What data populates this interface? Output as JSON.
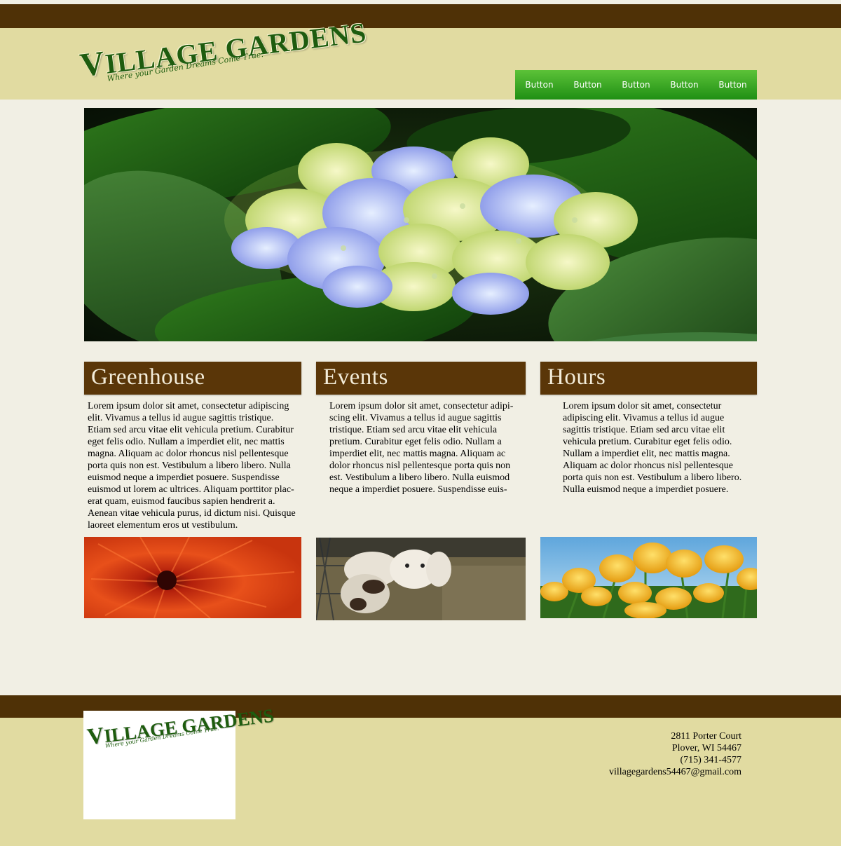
{
  "brand": {
    "name_first": "V",
    "name_rest": "ILLAGE GARDENS",
    "tagline": "Where your Garden Dreams Come True."
  },
  "nav": {
    "buttons": [
      "Button",
      "Button",
      "Button",
      "Button",
      "Button"
    ]
  },
  "columns": [
    {
      "title": "Greenhouse",
      "body": "Lorem ipsum dolor sit amet, consectetur adipiscing elit. Vivamus a tellus id augue sagittis tristique. Etiam sed arcu vitae elit vehicula pretium. Curabitur eget felis odio. Nullam a imperdiet elit, nec mattis magna. Aliquam ac dolor rhoncus nisl pellentesque porta quis non est. Vestibulum a libero libero. Nulla euismod neque a imperdiet posuere. Suspendisse euismod ut lorem ac ultrices. Aliquam porttitor plac-erat quam, euismod faucibus sapien hendrerit a. Aenean vitae vehicula purus, id dictum nisi. Quisque laoreet elementum eros ut vestibulum.",
      "image": "red-chrysanthemum"
    },
    {
      "title": "Events",
      "body": "Lorem ipsum dolor sit amet, consectetur adipi-scing elit. Vivamus a tellus id augue sagittis tristique. Etiam sed arcu vitae elit vehicula pretium. Curabitur eget felis odio. Nullam a imperdiet elit, nec mattis magna. Aliquam ac dolor rhoncus nisl pellentesque porta quis non est. Vestibulum a libero libero. Nulla euismod neque a imperdiet posuere. Suspendisse euis-",
      "image": "goats"
    },
    {
      "title": "Hours",
      "body": "Lorem ipsum dolor sit amet, consectetur adipiscing elit. Vivamus a tellus id augue sagittis tristique. Etiam sed arcu vitae elit vehicula pretium. Curabitur eget felis odio. Nullam a imperdiet elit, nec mattis magna. Aliquam ac dolor rhoncus nisl pellentesque porta quis non est. Vestibulum a libero libero. Nulla euismod neque a imperdiet posuere.",
      "image": "yellow-tulips"
    }
  ],
  "hero": {
    "image": "blue-hydrangea"
  },
  "footer": {
    "address_line1": "2811 Porter Court",
    "address_line2": "Plover, WI 54467",
    "phone": "(715) 341-4577",
    "email": "villagegardens54467@gmail.com"
  },
  "colors": {
    "brown": "#4f3106",
    "tan": "#e1dba1",
    "green_nav": "#2fa11f",
    "page_bg": "#f1efe4"
  }
}
